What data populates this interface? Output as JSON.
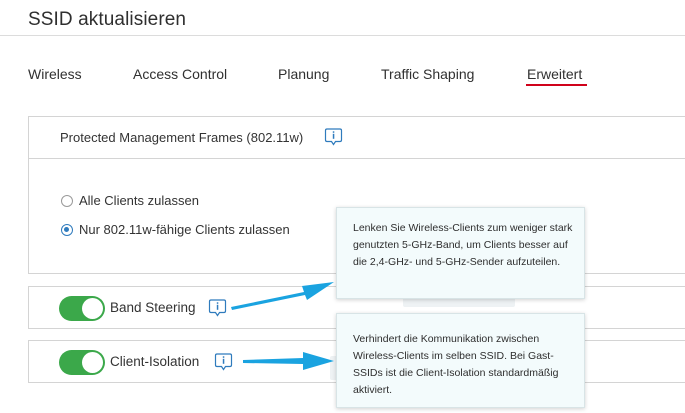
{
  "header": {
    "title": "SSID aktualisieren"
  },
  "tabs": [
    {
      "label": "Wireless",
      "active": false
    },
    {
      "label": "Access Control",
      "active": false
    },
    {
      "label": "Planung",
      "active": false
    },
    {
      "label": "Traffic Shaping",
      "active": false
    },
    {
      "label": "Erweitert",
      "active": true
    }
  ],
  "pmf": {
    "title": "Protected Management Frames (802.11w)",
    "info_icon": "info-icon",
    "options": [
      {
        "label": "Alle Clients zulassen",
        "selected": false
      },
      {
        "label": "Nur 802.11w-fähige Clients zulassen",
        "selected": true
      }
    ]
  },
  "band_steering": {
    "label": "Band Steering",
    "enabled": true,
    "info_icon": "info-icon",
    "tooltip": "Lenken Sie Wireless-Clients zum weniger stark genutzten 5-GHz-Band, um Clients besser auf die 2,4-GHz- und 5-GHz-Sender aufzuteilen."
  },
  "client_isolation": {
    "label": "Client-Isolation",
    "enabled": true,
    "info_icon": "info-icon",
    "tooltip": "Verhindert die Kommunikation zwischen Wireless-Clients im selben SSID. Bei Gast-SSIDs ist die Client-Isolation standardmäßig aktiviert."
  },
  "colors": {
    "active_tab_underline": "#d0021b",
    "toggle_on": "#3ba84a",
    "radio_selected": "#2f7bbd",
    "callout_arrow": "#1aa3e0",
    "tooltip_bg": "#f3fbfc"
  }
}
